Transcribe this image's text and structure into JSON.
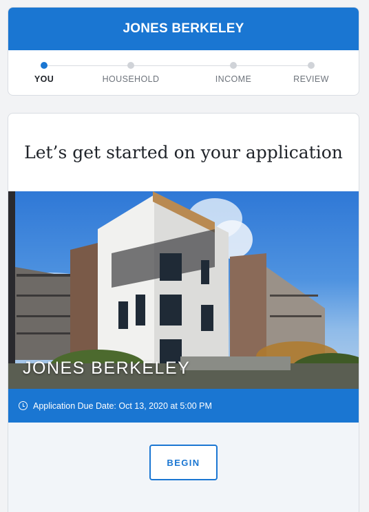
{
  "header": {
    "title": "JONES BERKELEY"
  },
  "steps": [
    {
      "label": "YOU",
      "active": true
    },
    {
      "label": "HOUSEHOLD",
      "active": false
    },
    {
      "label": "INCOME",
      "active": false
    },
    {
      "label": "REVIEW",
      "active": false
    }
  ],
  "application": {
    "heading": "Let’s get started on your application",
    "property_name": "JONES BERKELEY",
    "due_date_text": "Application Due Date: Oct 13, 2020 at 5:00 PM",
    "begin_label": "BEGIN"
  },
  "colors": {
    "accent": "#1a76d2"
  },
  "icons": {
    "due_date": "clock-icon"
  }
}
